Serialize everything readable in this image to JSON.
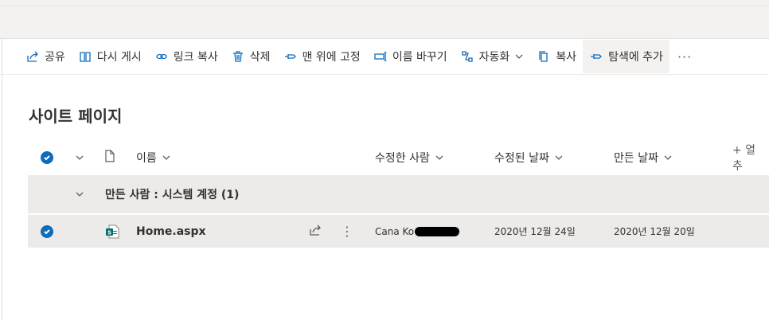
{
  "command_bar": {
    "items": [
      {
        "label": "공유",
        "icon": "share-icon"
      },
      {
        "label": "다시 게시",
        "icon": "book-icon"
      },
      {
        "label": "링크 복사",
        "icon": "link-icon"
      },
      {
        "label": "삭제",
        "icon": "trash-icon"
      },
      {
        "label": "맨 위에 고정",
        "icon": "pin-icon"
      },
      {
        "label": "이름 바꾸기",
        "icon": "rename-icon"
      },
      {
        "label": "자동화",
        "icon": "flow-icon",
        "has_dropdown": true
      },
      {
        "label": "복사",
        "icon": "copy-icon"
      },
      {
        "label": "탐색에 추가",
        "icon": "pin-icon",
        "highlighted": true
      }
    ],
    "more": "···"
  },
  "page": {
    "title": "사이트 페이지"
  },
  "columns": {
    "name": "이름",
    "modified_by": "수정한 사람",
    "modified": "수정된 날짜",
    "created": "만든 날짜",
    "add_column": "+ 열 추"
  },
  "group": {
    "label": "만든 사람 : 시스템 계정 (1)"
  },
  "rows": [
    {
      "name": "Home.aspx",
      "modified_by": "Cana Ko",
      "modified": "2020년 12월 24일",
      "created": "2020년 12월 20일",
      "selected": true
    }
  ],
  "colors": {
    "accent": "#0f6cbd",
    "row_bg": "#edebe9"
  }
}
